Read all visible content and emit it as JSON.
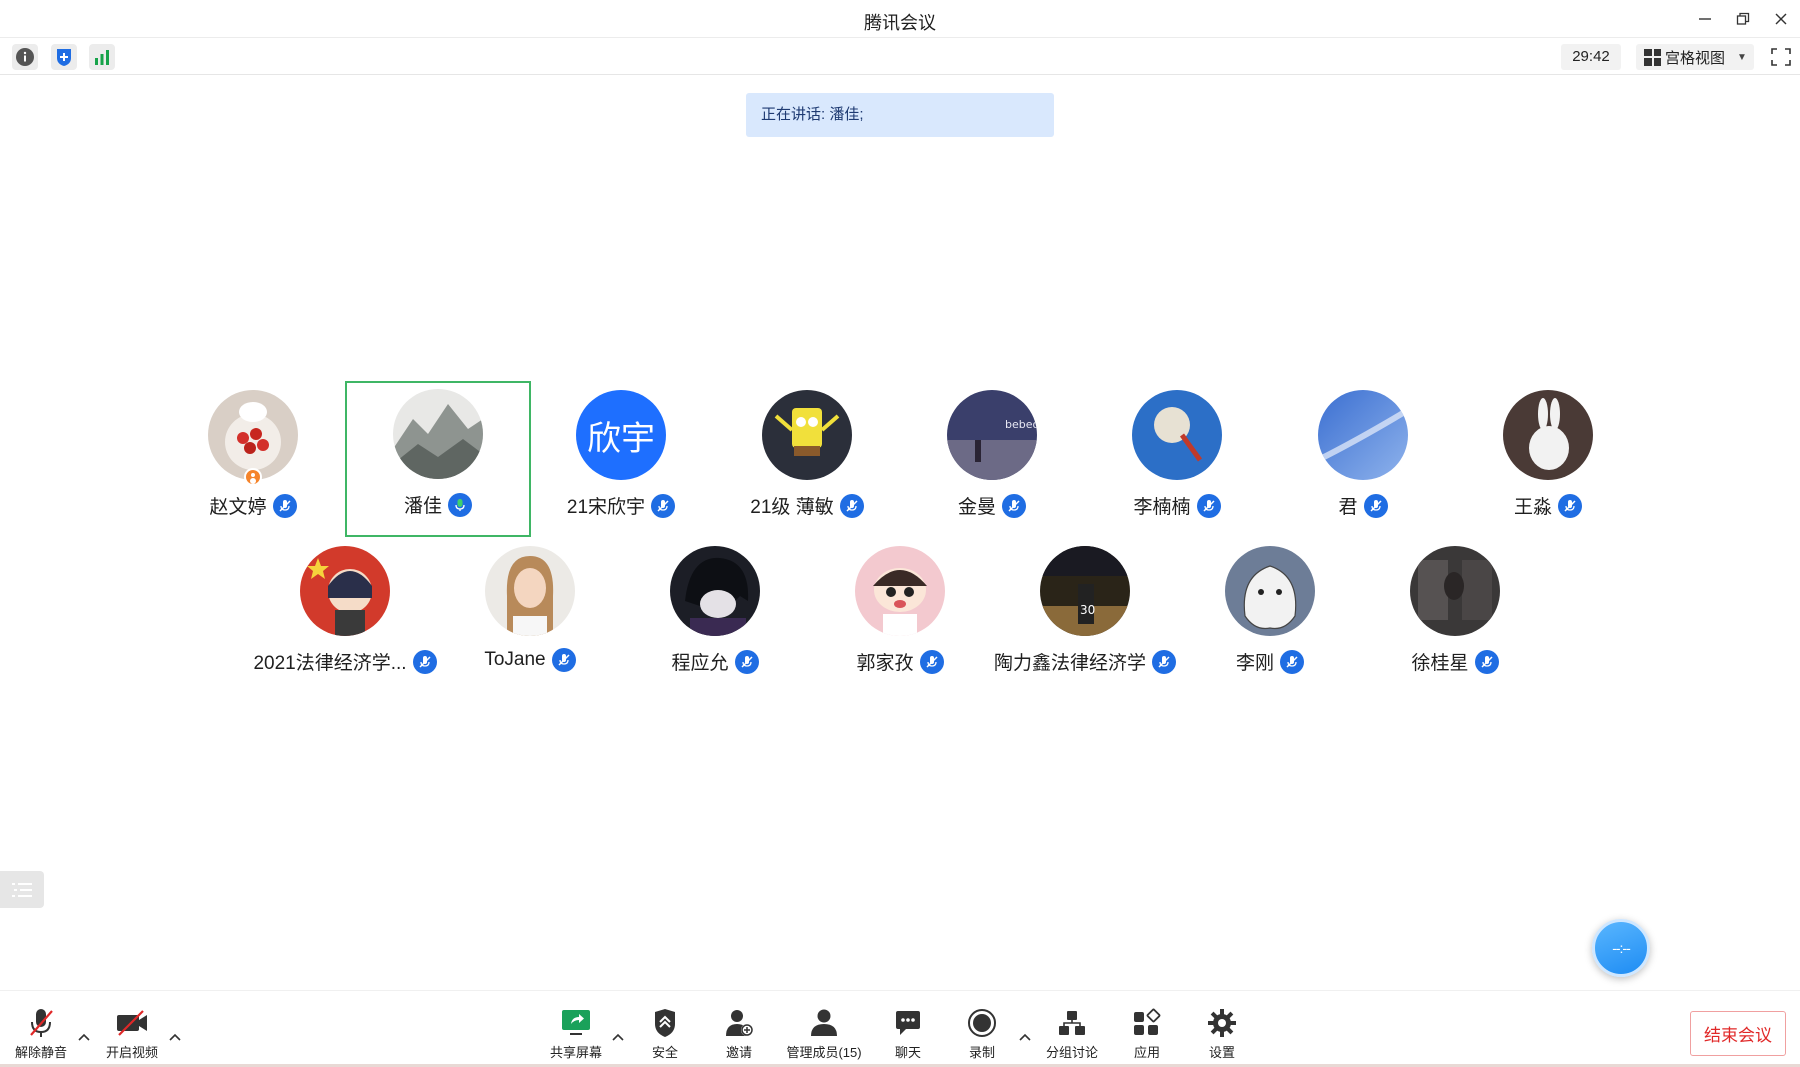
{
  "window": {
    "title": "腾讯会议",
    "minimize_icon": "minimize-icon",
    "restore_icon": "restore-icon",
    "close_icon": "close-icon"
  },
  "subbar": {
    "info_icon": "info-icon",
    "security_icon": "shield-icon",
    "signal_icon": "signal-icon",
    "timer": "29:42",
    "view_label": "宫格视图",
    "fullscreen_icon": "fullscreen-icon"
  },
  "speaking": {
    "text": "正在讲话: 潘佳;"
  },
  "participants": [
    {
      "name": "赵文婷",
      "mic": "muted",
      "host": true,
      "avatar": "strawberry-photo"
    },
    {
      "name": "潘佳",
      "mic": "live",
      "active": true,
      "avatar": "landscape-painting"
    },
    {
      "name": "21宋欣宇",
      "mic": "muted",
      "avatar_text": "欣宇"
    },
    {
      "name": "21级 薄敏",
      "mic": "muted",
      "avatar": "spongebob"
    },
    {
      "name": "金曼",
      "mic": "muted",
      "avatar": "night-beach"
    },
    {
      "name": "李楠楠",
      "mic": "muted",
      "avatar": "dandelion"
    },
    {
      "name": "君",
      "mic": "muted",
      "avatar": "blue-sky"
    },
    {
      "name": "王淼",
      "mic": "muted",
      "avatar": "snow-rabbit"
    },
    {
      "name": "2021法律经济学...",
      "mic": "muted",
      "avatar": "flag-girl"
    },
    {
      "name": "ToJane",
      "mic": "muted",
      "avatar": "woman-portrait"
    },
    {
      "name": "程应允",
      "mic": "muted",
      "avatar": "anime-boy"
    },
    {
      "name": "郭家孜",
      "mic": "muted",
      "avatar": "cartoon-kid"
    },
    {
      "name": "陶力鑫法律经济学",
      "mic": "muted",
      "avatar": "basketball-30"
    },
    {
      "name": "李刚",
      "mic": "muted",
      "avatar": "white-dog-sketch"
    },
    {
      "name": "徐桂星",
      "mic": "muted",
      "avatar": "dark-photo"
    }
  ],
  "float_ball": {
    "text": "--:--"
  },
  "toolbar": {
    "unmute_label": "解除静音",
    "video_label": "开启视频",
    "share_label": "共享屏幕",
    "security_label": "安全",
    "invite_label": "邀请",
    "members_label": "管理成员(15)",
    "chat_label": "聊天",
    "record_label": "录制",
    "breakout_label": "分组讨论",
    "apps_label": "应用",
    "settings_label": "设置",
    "end_label": "结束会议"
  },
  "colors": {
    "accent": "#1f6de3",
    "active_border": "#3fb665",
    "speaking_bg": "#d9e8fd",
    "end_red": "#e02828",
    "share_green": "#1aa15a"
  }
}
